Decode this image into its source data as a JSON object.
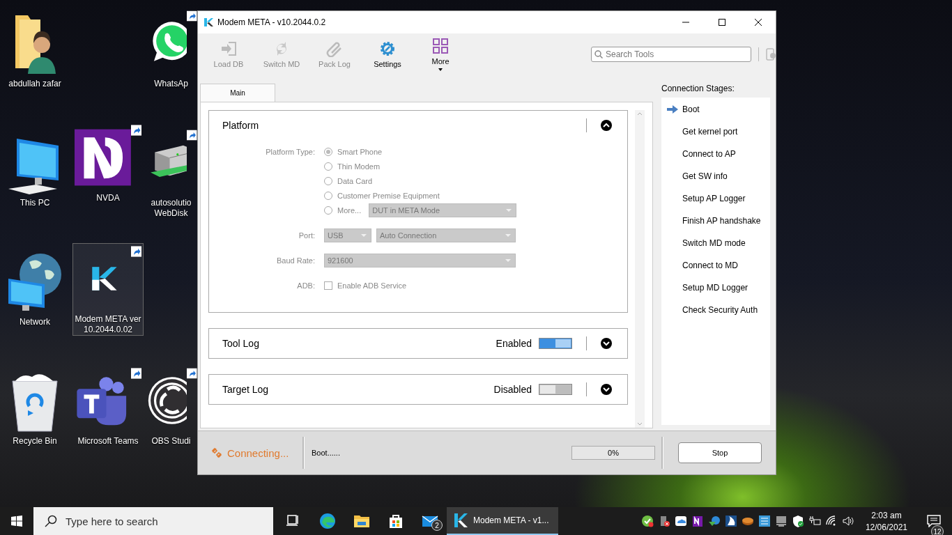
{
  "desktop": {
    "icons": [
      {
        "label": "abdullah zafar",
        "kind": "user-folder",
        "shortcut": false,
        "selected": false
      },
      {
        "label": "WhatsAp",
        "kind": "chat",
        "shortcut": true,
        "selected": false
      },
      {
        "label": "This PC",
        "kind": "computer",
        "shortcut": false,
        "selected": false
      },
      {
        "label": "NVDA",
        "kind": "nvda",
        "shortcut": true,
        "selected": false
      },
      {
        "label": "autosolutio WebDisk",
        "kind": "server",
        "shortcut": true,
        "selected": false
      },
      {
        "label": "Network",
        "kind": "network",
        "shortcut": false,
        "selected": false
      },
      {
        "label": "Modem META ver 10.2044.0.02",
        "kind": "meta",
        "shortcut": true,
        "selected": true
      },
      {
        "label": "Recycle Bin",
        "kind": "recycle",
        "shortcut": false,
        "selected": false
      },
      {
        "label": "Microsoft Teams",
        "kind": "teams",
        "shortcut": true,
        "selected": false
      },
      {
        "label": "OBS Studi",
        "kind": "obs",
        "shortcut": true,
        "selected": false
      }
    ]
  },
  "window": {
    "title": "Modem META - v10.2044.0.2",
    "toolbar": [
      {
        "label": "Load DB",
        "kind": "load",
        "disabled": true
      },
      {
        "label": "Switch MD",
        "kind": "switch",
        "disabled": true
      },
      {
        "label": "Pack Log",
        "kind": "clip",
        "disabled": true
      },
      {
        "label": "Settings",
        "kind": "gear",
        "disabled": false
      },
      {
        "label": "More",
        "kind": "grid",
        "disabled": false
      }
    ],
    "search": {
      "placeholder": "Search Tools"
    },
    "tabs": [
      {
        "label": "Main",
        "selected": true
      }
    ],
    "platform": {
      "title": "Platform",
      "expanded": true,
      "disabled": true,
      "type_label": "Platform Type:",
      "options": [
        {
          "label": "Smart Phone",
          "selected": true
        },
        {
          "label": "Thin Modem",
          "selected": false
        },
        {
          "label": "Data Card",
          "selected": false
        },
        {
          "label": "Customer Premise Equipment",
          "selected": false
        },
        {
          "label": "More...",
          "selected": false
        }
      ],
      "more_value": "DUT in META Mode",
      "port_label": "Port:",
      "port_value": "USB",
      "connection_value": "Auto Connection",
      "baud_label": "Baud Rate:",
      "baud_value": "921600",
      "adb_label": "ADB:",
      "adb_option": "Enable ADB Service",
      "adb_checked": false
    },
    "logs": [
      {
        "title": "Tool Log",
        "status": "Enabled",
        "on": true,
        "expanded": false
      },
      {
        "title": "Target Log",
        "status": "Disabled",
        "on": false,
        "expanded": false
      }
    ],
    "stages": {
      "title": "Connection Stages:",
      "items": [
        {
          "label": "Boot",
          "current": true
        },
        {
          "label": "Get kernel port",
          "current": false
        },
        {
          "label": "Connect to AP",
          "current": false
        },
        {
          "label": "Get SW info",
          "current": false
        },
        {
          "label": "Setup AP Logger",
          "current": false
        },
        {
          "label": "Finish AP handshake",
          "current": false
        },
        {
          "label": "Switch MD mode",
          "current": false
        },
        {
          "label": "Connect to MD",
          "current": false
        },
        {
          "label": "Setup MD Logger",
          "current": false
        },
        {
          "label": "Check Security Auth",
          "current": false
        }
      ]
    },
    "status_bar": {
      "state": "Connecting...",
      "message": "Boot......",
      "level": 0,
      "reading": "0%",
      "button": "Stop"
    }
  },
  "taskbar": {
    "search": {
      "placeholder": "Type here to search"
    },
    "apps": [
      {
        "kind": "task-view",
        "active": false
      },
      {
        "kind": "browser",
        "active": false
      },
      {
        "kind": "folder",
        "active": false
      },
      {
        "kind": "store",
        "active": false
      },
      {
        "kind": "mail",
        "badge": "2",
        "active": false
      },
      {
        "kind": "meta",
        "label": "Modem META - v1...",
        "active": true
      }
    ],
    "tray": [
      {
        "kind": "check"
      },
      {
        "kind": "phone"
      },
      {
        "kind": "cloud"
      },
      {
        "kind": "note"
      },
      {
        "kind": "globe"
      },
      {
        "kind": "sail"
      },
      {
        "kind": "disc"
      },
      {
        "kind": "board"
      },
      {
        "kind": "monitor"
      },
      {
        "kind": "shield"
      },
      {
        "kind": "battery"
      },
      {
        "kind": "wifi"
      },
      {
        "kind": "speaker"
      }
    ],
    "time": "2:03 am",
    "date": "12/06/2021",
    "notifications": "12"
  }
}
